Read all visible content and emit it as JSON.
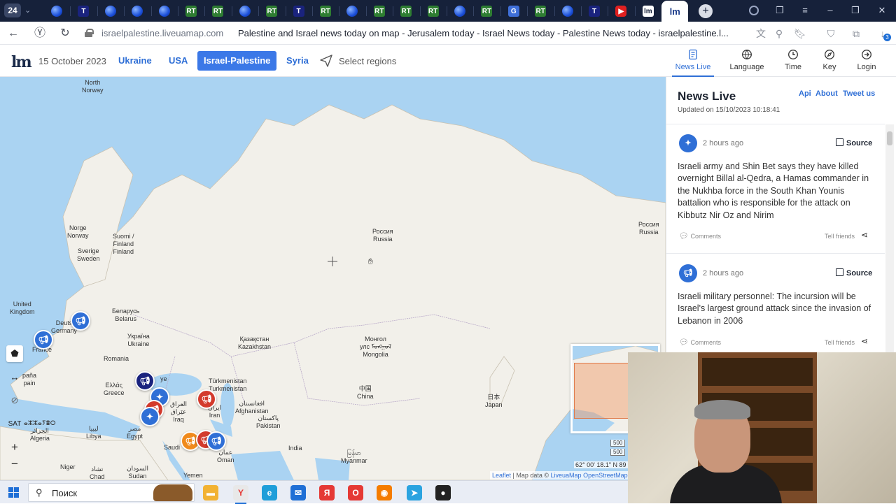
{
  "browser": {
    "tab_counter": "24",
    "tabs": [
      {
        "icon": "globe-icon",
        "kind": "globe"
      },
      {
        "icon": "t-icon",
        "kind": "t",
        "letter": "T"
      },
      {
        "icon": "globe-icon",
        "kind": "globe"
      },
      {
        "icon": "globe-icon",
        "kind": "globe"
      },
      {
        "icon": "globe-icon",
        "kind": "globe"
      },
      {
        "icon": "rt-icon",
        "kind": "rt",
        "letter": "RT"
      },
      {
        "icon": "rt-icon",
        "kind": "rt",
        "letter": "RT"
      },
      {
        "icon": "globe-icon",
        "kind": "globe"
      },
      {
        "icon": "rt-icon",
        "kind": "rt",
        "letter": "RT"
      },
      {
        "icon": "t-icon",
        "kind": "t",
        "letter": "T"
      },
      {
        "icon": "rt-icon",
        "kind": "rt",
        "letter": "RT"
      },
      {
        "icon": "globe-icon",
        "kind": "globe"
      },
      {
        "icon": "rt-icon",
        "kind": "rt",
        "letter": "RT"
      },
      {
        "icon": "rt-icon",
        "kind": "rt",
        "letter": "RT"
      },
      {
        "icon": "rt-icon",
        "kind": "rt",
        "letter": "RT"
      },
      {
        "icon": "globe-icon",
        "kind": "globe"
      },
      {
        "icon": "rt-icon",
        "kind": "rt",
        "letter": "RT"
      },
      {
        "icon": "translate-icon",
        "kind": "tr",
        "letter": "G"
      },
      {
        "icon": "rt-icon",
        "kind": "rt",
        "letter": "RT"
      },
      {
        "icon": "globe-icon",
        "kind": "globe"
      },
      {
        "icon": "t-icon",
        "kind": "t",
        "letter": "T"
      },
      {
        "icon": "youtube-icon",
        "kind": "yt",
        "letter": "▶"
      },
      {
        "icon": "liveuamap-icon",
        "kind": "lm",
        "letter": "lm"
      },
      {
        "icon": "liveuamap-icon",
        "kind": "active",
        "letter": "lm"
      }
    ],
    "url_host": "israelpalestine.liveuamap.com",
    "page_title": "Palestine and Israel news today on map - Jerusalem today - Israel News today - Palestine News today - israelpalestine.l...",
    "notification_count": "3"
  },
  "site": {
    "logo": "lm",
    "date": "15 October 2023",
    "regions": [
      "Ukraine",
      "USA",
      "Israel-Palestine",
      "Syria"
    ],
    "active_region": "Israel-Palestine",
    "select_regions_label": "Select regions",
    "menu": [
      {
        "label": "News Live",
        "icon": "document-icon",
        "active": true
      },
      {
        "label": "Language",
        "icon": "language-icon",
        "active": false
      },
      {
        "label": "Time",
        "icon": "clock-icon",
        "active": false
      },
      {
        "label": "Key",
        "icon": "compass-icon",
        "active": false
      },
      {
        "label": "Login",
        "icon": "login-icon",
        "active": false
      }
    ]
  },
  "map": {
    "places": {
      "north_norway": "North\nNorway",
      "norge_norway": "Norge\nNorway",
      "suomi_finland": "Suomi /\nFinland\nFinland",
      "sverige_sweden": "Sverige\nSweden",
      "russia_center": "Россия\nRussia",
      "russia_east": "Россия\nRussia",
      "united_kingdom": "United\nKingdom",
      "deutschland": "Deuts\nGermany",
      "belarus": "Беларусь\nBelarus",
      "ukraine": "Україна\nUkraine",
      "france": "France",
      "romania": "Romania",
      "kazakhstan": "Қазақстан\nKazakhstan",
      "mongolia": "Монгол\nулс ᠮᠣᠩᠭᠣᠯ\nMongolia",
      "spain": "paña\npain",
      "greece": "Ελλάς\nGreece",
      "turkiye": "ye",
      "turkmenistan": "Türkmenistan\nTurkmenistan",
      "iraq": "العراق\nعێراق\nIraq",
      "iran": "ایران\nIran",
      "afghanistan": "افغانستان\nAfghanistan",
      "pakistan": "پاکستان\nPakistan",
      "china": "中国\nChina",
      "japan": "日本\nJapan",
      "algeria": "ⴰⵣⵣⴰⵢⴻⵔ\nالجزائر\nAlgeria",
      "libya": "ليبيا\nLibya",
      "egypt": "مصر\nEgypt",
      "saudi": "Saudi",
      "oman": "عمان\nOman",
      "india": "India",
      "myanmar": "မြန်မာ\nMyanmar",
      "niger": "Niger",
      "sudan": "السودان\nSudan",
      "chad": "تشاد\nChad",
      "yemen": "Yemen"
    },
    "markers": [
      {
        "icon": "megaphone-icon",
        "color": "blue"
      },
      {
        "icon": "megaphone-icon",
        "color": "blue"
      },
      {
        "icon": "megaphone-icon",
        "color": "navy"
      },
      {
        "icon": "bomb-icon",
        "color": "blue"
      },
      {
        "icon": "megaphone-icon",
        "color": "red"
      },
      {
        "icon": "bomb-icon",
        "color": "blue"
      },
      {
        "icon": "megaphone-icon",
        "color": "red"
      },
      {
        "icon": "megaphone-icon",
        "color": "orange"
      },
      {
        "icon": "megaphone-icon",
        "color": "red"
      },
      {
        "icon": "megaphone-icon",
        "color": "blue"
      }
    ],
    "tools": {
      "polygon": "⬟",
      "measure": "↔",
      "hide": "⊘",
      "sat": "SAT",
      "zoom_in": "+",
      "zoom_out": "−"
    },
    "scale_1": "500",
    "scale_2": "500",
    "coordinates": "62° 00' 18.1\" N 89",
    "attribution_leaflet": "Leaflet",
    "attribution_text": " | Map data © ",
    "attribution_liveuamap": "LiveuaMap",
    "attribution_osm": "OpenStreetMap"
  },
  "news": {
    "title": "News Live",
    "links": [
      "Api",
      "About",
      "Tweet us"
    ],
    "updated": "Updated on 15/10/2023 10:18:41",
    "source_label": "Source",
    "comments_label": "Comments",
    "tell_label": "Tell friends",
    "items": [
      {
        "time": "2 hours ago",
        "icon": "bomb-icon",
        "text": "Israeli army and Shin Bet says they have killed overnight Billal al-Qedra, a Hamas commander in the Nukhba force in the South Khan Younis battalion who is responsible for the attack on Kibbutz Nir Oz and Nirim"
      },
      {
        "time": "2 hours ago",
        "icon": "megaphone-icon",
        "text": "Israeli military personnel: The incursion will be Israel's largest ground attack since the invasion of Lebanon in 2006"
      }
    ]
  },
  "taskbar": {
    "search_placeholder": "Поиск",
    "apps": [
      {
        "name": "file-explorer-icon",
        "color": "#f2b233",
        "glyph": "▬"
      },
      {
        "name": "yandex-browser-icon",
        "color": "#e8e8e8",
        "glyph": "Y"
      },
      {
        "name": "edge-icon",
        "color": "#1f9ed9",
        "glyph": "e"
      },
      {
        "name": "mail-icon",
        "color": "#1f6fd6",
        "glyph": "✉"
      },
      {
        "name": "yandex-icon",
        "color": "#e53935",
        "glyph": "Я"
      },
      {
        "name": "opera-icon",
        "color": "#e53935",
        "glyph": "O"
      },
      {
        "name": "firefox-icon",
        "color": "#f57c00",
        "glyph": "◉"
      },
      {
        "name": "telegram-icon",
        "color": "#2aa3e0",
        "glyph": "➤"
      },
      {
        "name": "obs-icon",
        "color": "#222",
        "glyph": "●"
      }
    ]
  },
  "colors": {
    "accent": "#3b78e7",
    "link": "#2f6fd6",
    "marker_blue": "#2f6fd6",
    "marker_red": "#d33a2c",
    "marker_orange": "#f08a1c",
    "marker_navy": "#1a237e",
    "sea": "#aad3f2",
    "land": "#f2f0ea"
  }
}
